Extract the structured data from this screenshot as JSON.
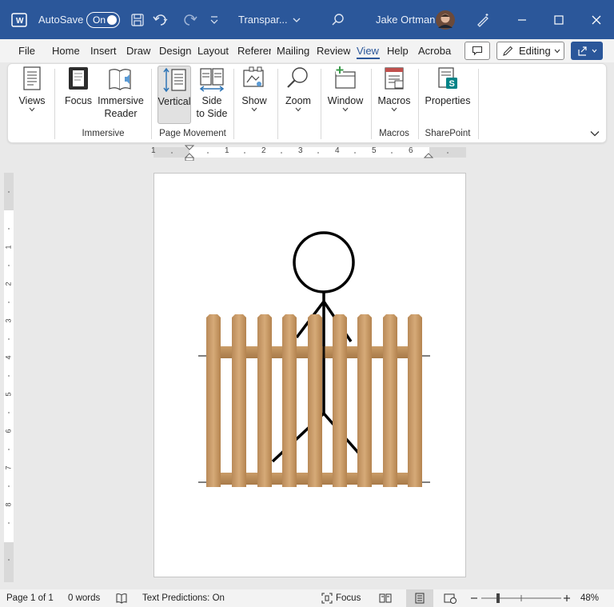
{
  "titlebar": {
    "autosave_label": "AutoSave",
    "autosave_state": "On",
    "doc_title": "Transpar...",
    "user_name": "Jake Ortman",
    "bg_color": "#2b579a"
  },
  "tabs": [
    "File",
    "Home",
    "Insert",
    "Draw",
    "Design",
    "Layout",
    "Referer",
    "Mailing",
    "Review",
    "View",
    "Help",
    "Acroba"
  ],
  "active_tab": "View",
  "editing_label": "Editing",
  "ribbon": {
    "views": "Views",
    "focus": "Focus",
    "immersive_reader_1": "Immersive",
    "immersive_reader_2": "Reader",
    "vertical": "Vertical",
    "side_1": "Side",
    "side_2": "to Side",
    "show": "Show",
    "zoom": "Zoom",
    "window": "Window",
    "macros": "Macros",
    "properties": "Properties",
    "groups": {
      "immersive": "Immersive",
      "page_movement": "Page Movement",
      "macros": "Macros",
      "sharepoint": "SharePoint"
    }
  },
  "ruler": {
    "h_ticks": [
      "1",
      "1",
      "2",
      "3",
      "4",
      "5",
      "6"
    ],
    "v_ticks": [
      "1",
      "2",
      "3",
      "4",
      "5",
      "6",
      "7",
      "8"
    ]
  },
  "statusbar": {
    "page": "Page 1 of 1",
    "words": "0 words",
    "text_predictions": "Text Predictions: On",
    "focus": "Focus",
    "zoom_pct": "48%"
  },
  "zoom_level": 48,
  "colors": {
    "accent": "#2b579a",
    "wood": "#c89a66"
  }
}
